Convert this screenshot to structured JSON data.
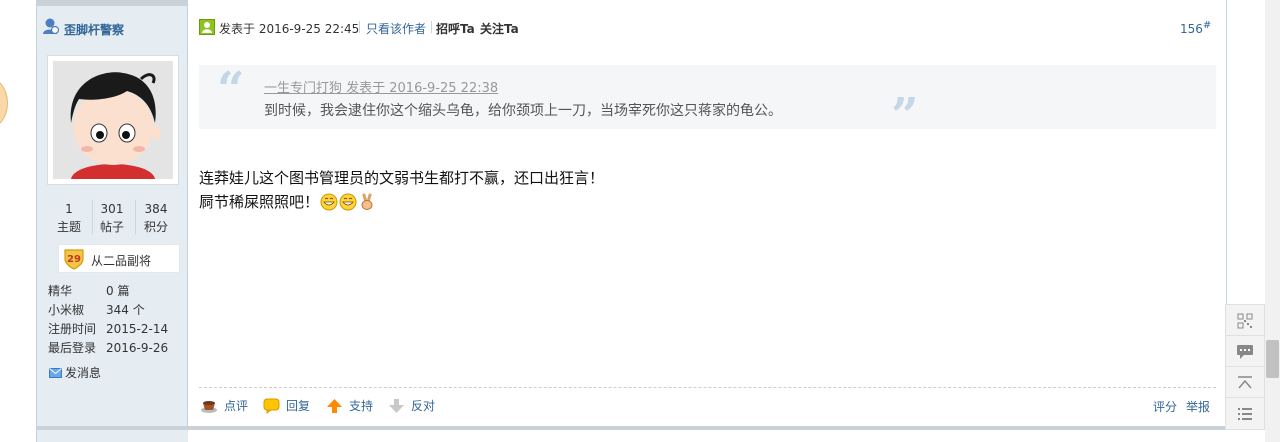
{
  "author": {
    "name": "歪脚杆警察",
    "stats": [
      {
        "value": "1",
        "label": "主题"
      },
      {
        "value": "301",
        "label": "帖子"
      },
      {
        "value": "384",
        "label": "积分"
      }
    ],
    "medal_level": "29",
    "medal_label": "从二品副将",
    "info": [
      {
        "key": "精华",
        "value": "0 篇"
      },
      {
        "key": "小米椒",
        "value": "344 个"
      },
      {
        "key": "注册时间",
        "value": "2015-2-14"
      },
      {
        "key": "最后登录",
        "value": "2016-9-26"
      }
    ],
    "pm_label": "发消息"
  },
  "post": {
    "posted_at": "发表于 2016-9-25 22:45",
    "only_author": "只看该作者",
    "greet": "招呼Ta",
    "follow": "关注Ta",
    "floor": "156",
    "floor_mark": "#",
    "quote": {
      "meta": "一生专门打狗 发表于 2016-9-25 22:38",
      "text": "到时候，我会逮住你这个缩头乌龟，给你颈项上一刀，当场宰死你这只蒋家的龟公。"
    },
    "body_line1": "连莽娃儿这个图书管理员的文弱书生都打不赢，还口出狂言！",
    "body_line2": "屙节稀屎照照吧！"
  },
  "actions": {
    "comment": "点评",
    "reply": "回复",
    "support": "支持",
    "oppose": "反对",
    "rate": "评分",
    "report": "举报"
  },
  "colors": {
    "link": "#336699",
    "sidebar_bg": "#e5edf2",
    "quote_bg": "#f4f6f8"
  }
}
